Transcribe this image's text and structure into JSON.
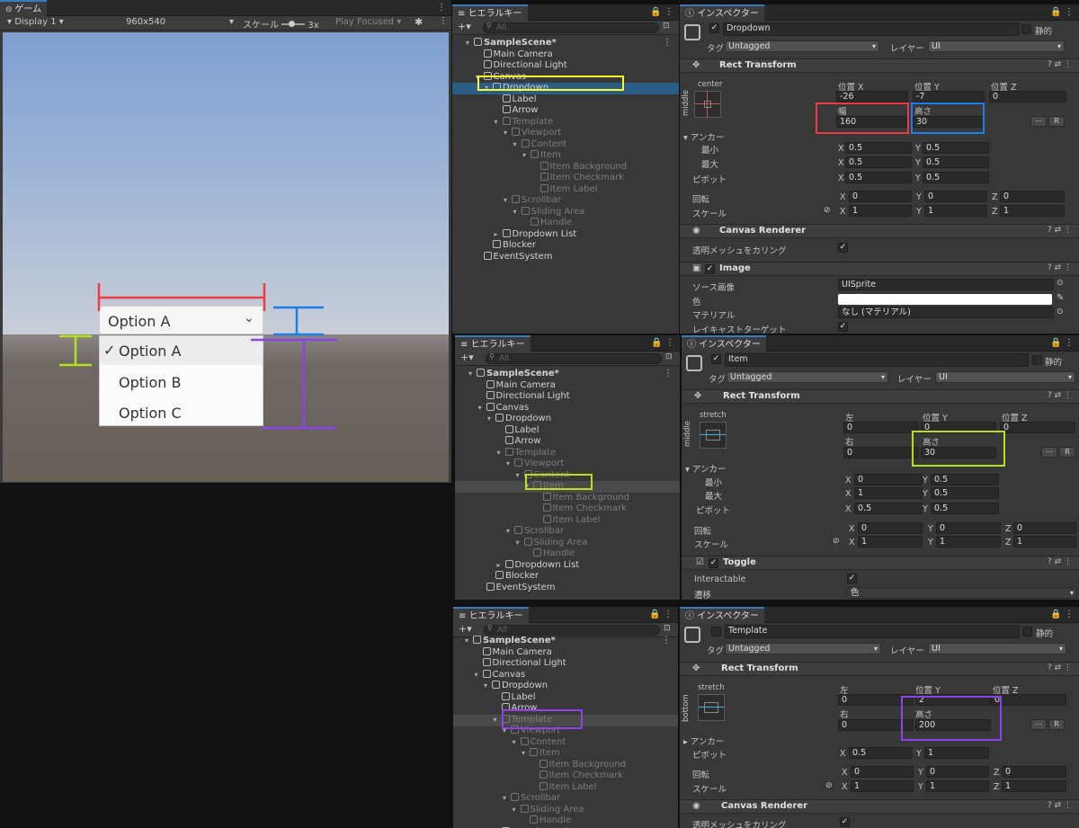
{
  "game": {
    "tab": "ゲーム",
    "display": "Display 1",
    "resolution": "960x540",
    "scale_label": "スケール",
    "scale_value": "3x",
    "play_focused": "Play Focused",
    "dropdown_label": "Option A",
    "options": [
      "Option A",
      "Option B",
      "Option C"
    ],
    "checkmark": "✓"
  },
  "colors": {
    "red": "#ee3a45",
    "blue": "#1a7fe8",
    "green": "#b5e11d",
    "purple": "#8a44e8",
    "yellow": "#ffff2a"
  },
  "hier": {
    "tab": "ヒエラルキー",
    "search": "All",
    "plus": "+▾",
    "rows": [
      "SampleScene*",
      "Main Camera",
      "Directional Light",
      "Canvas",
      "Dropdown",
      "Label",
      "Arrow",
      "Template",
      "Viewport",
      "Content",
      "Item",
      "Item Background",
      "Item Checkmark",
      "Item Label",
      "Scrollbar",
      "Sliding Area",
      "Handle",
      "Dropdown List",
      "Blocker",
      "EventSystem"
    ]
  },
  "ins": {
    "tab": "インスペクター",
    "tag_label": "タグ",
    "tag_value": "Untagged",
    "layer_label": "レイヤー",
    "layer_value": "UI",
    "static_label": "静的",
    "rect_transform": "Rect Transform",
    "canvas_renderer": "Canvas Renderer",
    "cull_label": "透明メッシュをカリング",
    "anchor_label": "アンカー",
    "min_label": "最小",
    "max_label": "最大",
    "pivot_label": "ピボット",
    "rotation_label": "回転",
    "scale_label": "スケール",
    "left_label": "左",
    "right_label": "右",
    "posx_label": "位置 X",
    "posy_label": "位置 Y",
    "posz_label": "位置 Z",
    "width_label": "幅",
    "height_label": "高さ",
    "x": "X",
    "y": "Y",
    "z": "Z",
    "r_button": "R",
    "p1": {
      "name": "Dropdown",
      "anchor_preset": "center",
      "anchor_side": "middle",
      "pos": [
        "-26",
        "-7",
        "0"
      ],
      "width": "160",
      "height": "30",
      "anchor_min": [
        "0.5",
        "0.5"
      ],
      "anchor_max": [
        "0.5",
        "0.5"
      ],
      "pivot": [
        "0.5",
        "0.5"
      ],
      "rotation": [
        "0",
        "0",
        "0"
      ],
      "scale": [
        "1",
        "1",
        "1"
      ],
      "image": "Image",
      "source_label": "ソース画像",
      "source_value": "UISprite",
      "color_label": "色",
      "material_label": "マテリアル",
      "material_value": "なし (マテリアル)",
      "raycast_label": "レイキャストターゲット"
    },
    "p2": {
      "name": "Item",
      "anchor_preset": "stretch",
      "anchor_side": "middle",
      "left": "0",
      "posy": "0",
      "posz": "0",
      "right": "0",
      "height": "30",
      "anchor_min": [
        "0",
        "0.5"
      ],
      "anchor_max": [
        "1",
        "0.5"
      ],
      "pivot": [
        "0.5",
        "0.5"
      ],
      "rotation": [
        "0",
        "0",
        "0"
      ],
      "scale": [
        "1",
        "1",
        "1"
      ],
      "toggle": "Toggle",
      "interactable_label": "Interactable",
      "transition_label": "遷移",
      "transition_value": "色"
    },
    "p3": {
      "name": "Template",
      "anchor_preset": "stretch",
      "anchor_side": "bottom",
      "left": "0",
      "posy": "2",
      "posz": "0",
      "right": "0",
      "height": "200",
      "pivot": [
        "0.5",
        "1"
      ],
      "rotation": [
        "0",
        "0",
        "0"
      ],
      "scale": [
        "1",
        "1",
        "1"
      ]
    }
  }
}
